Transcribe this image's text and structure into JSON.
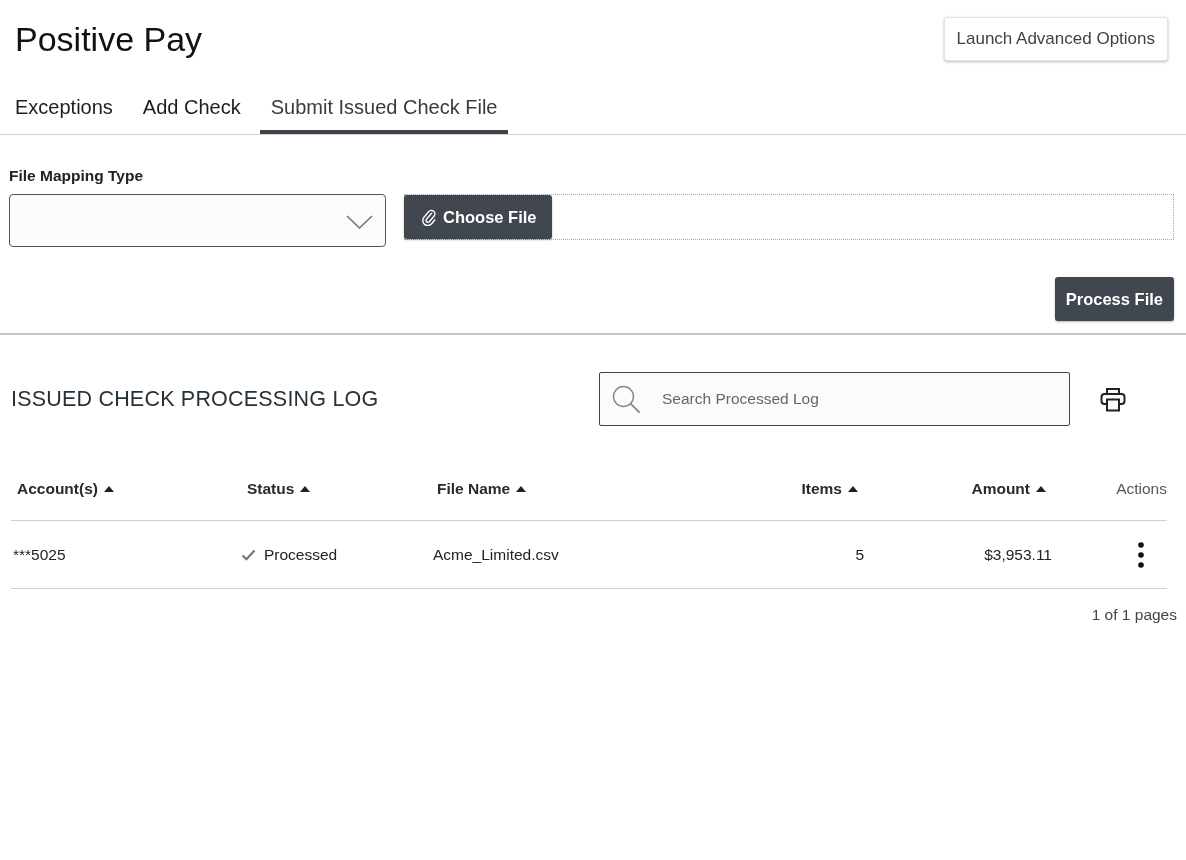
{
  "header": {
    "title": "Positive Pay",
    "action_button": "Launch Advanced Options"
  },
  "tabs": [
    {
      "label": "Exceptions",
      "selected": false
    },
    {
      "label": "Add Check",
      "selected": false
    },
    {
      "label": "Submit Issued Check File",
      "selected": true
    }
  ],
  "upload_form": {
    "mapping_label": "File Mapping Type",
    "choose_file_button": "Choose File",
    "process_button": "Process File"
  },
  "log": {
    "title": "ISSUED CHECK PROCESSING LOG",
    "search": {
      "placeholder": "Search Processed Log"
    },
    "table": {
      "columns": [
        {
          "label": "Account(s)",
          "kind": "text",
          "sortable": true
        },
        {
          "label": "Status",
          "kind": "status",
          "sortable": true
        },
        {
          "label": "File Name",
          "kind": "text",
          "sortable": true
        },
        {
          "label": "Items",
          "kind": "number",
          "sortable": true
        },
        {
          "label": "Amount",
          "kind": "number",
          "sortable": true
        },
        {
          "label": "Actions",
          "kind": "actions",
          "sortable": false
        }
      ],
      "rows": [
        {
          "cells": [
            "***5025",
            "Processed",
            "Acme_Limited.csv",
            "5",
            "$3,953.11"
          ],
          "completed": true
        }
      ]
    },
    "pagination": "1 of 1 pages"
  }
}
